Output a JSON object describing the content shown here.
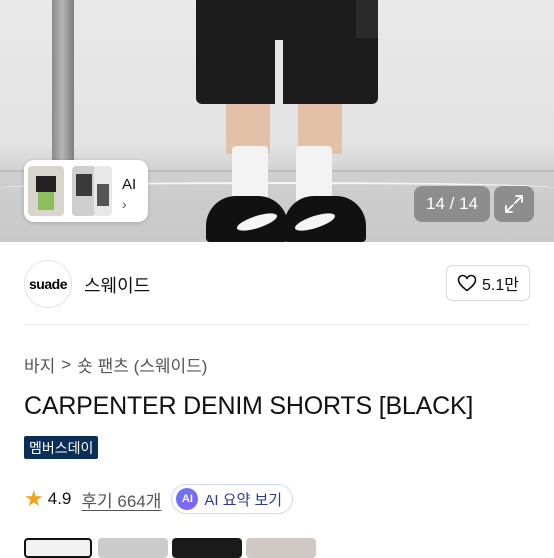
{
  "gallery": {
    "ai_card_label": "AI",
    "ai_card_chevron": "›",
    "counter": "14 / 14",
    "expand_icon": "expand-icon"
  },
  "brand": {
    "logo_text": "suade",
    "name": "스웨이드",
    "likes": "5.1만",
    "like_icon": "heart-icon"
  },
  "breadcrumb": {
    "category": "바지",
    "separator": ">",
    "subcategory": "숏 팬츠 (스웨이드)"
  },
  "product": {
    "title": "CARPENTER DENIM SHORTS [BLACK]",
    "badge": "멤버스데이",
    "rating": "4.9",
    "reviews": "후기 664개",
    "ai_summary_icon_text": "AI",
    "ai_summary_label": "AI 요약 보기"
  },
  "colors": {
    "badge_bg": "#0b2e59",
    "star": "#f4a21d",
    "ai_accent": "#5d7cf2"
  }
}
